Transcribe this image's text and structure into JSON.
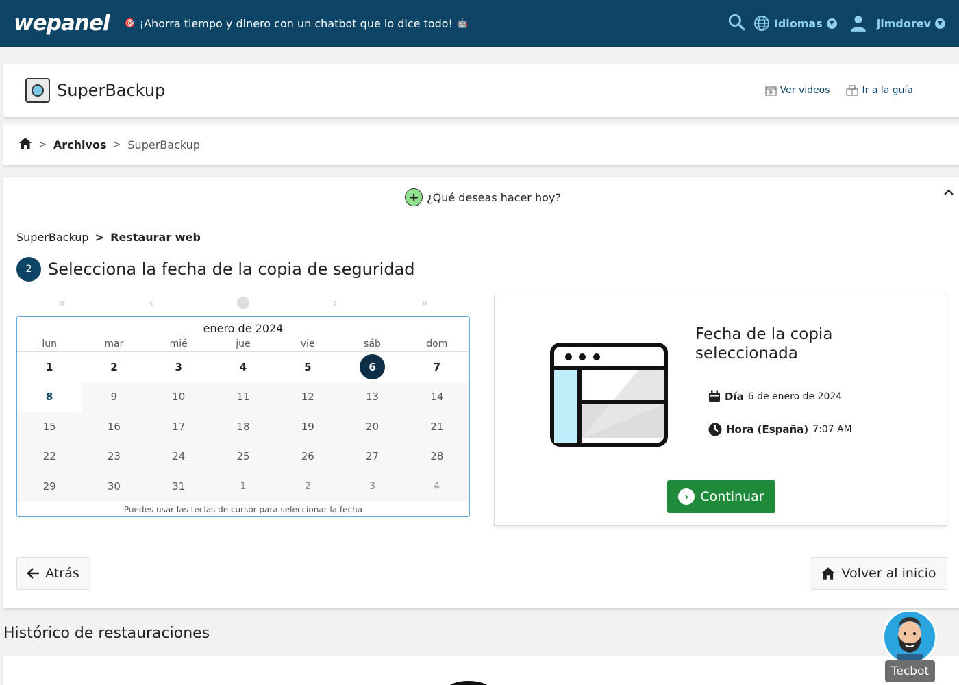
{
  "topbar": {
    "logo": "wepanel",
    "promo": "¡Ahorra tiempo y dinero con un chatbot que lo dice todo!",
    "languages": "Idiomas",
    "user": "jimdorev"
  },
  "title": {
    "name": "SuperBackup",
    "videos": "Ver videos",
    "guide": "Ir a la guía"
  },
  "breadcrumb": {
    "section": "Archivos",
    "current": "SuperBackup"
  },
  "main": {
    "question": "¿Qué deseas hacer hoy?",
    "sub_crumb_root": "SuperBackup",
    "sub_crumb_sep": ">",
    "sub_crumb_current": "Restaurar web",
    "step_number": "2",
    "step_title": "Selecciona la fecha de la copia de seguridad"
  },
  "calendar": {
    "month": "enero de 2024",
    "weekdays": [
      "lun",
      "mar",
      "mié",
      "jue",
      "vie",
      "sáb",
      "dom"
    ],
    "days": [
      [
        "1",
        "2",
        "3",
        "4",
        "5",
        "6",
        "7"
      ],
      [
        "8",
        "9",
        "10",
        "11",
        "12",
        "13",
        "14"
      ],
      [
        "15",
        "16",
        "17",
        "18",
        "19",
        "20",
        "21"
      ],
      [
        "22",
        "23",
        "24",
        "25",
        "26",
        "27",
        "28"
      ],
      [
        "29",
        "30",
        "31",
        "1",
        "2",
        "3",
        "4"
      ]
    ],
    "selected_day": "6",
    "footer": "Puedes usar las teclas de cursor para seleccionar la fecha"
  },
  "selection": {
    "title": "Fecha de la copia seleccionada",
    "day_label": "Día",
    "day_value": "6 de enero de 2024",
    "time_label": "Hora (España)",
    "time_value": "7:07 AM",
    "continue": "Continuar"
  },
  "nav": {
    "back": "Atrás",
    "home": "Volver al inicio"
  },
  "history": {
    "title": "Histórico de restauraciones"
  },
  "bot": {
    "label": "Tecbot"
  }
}
